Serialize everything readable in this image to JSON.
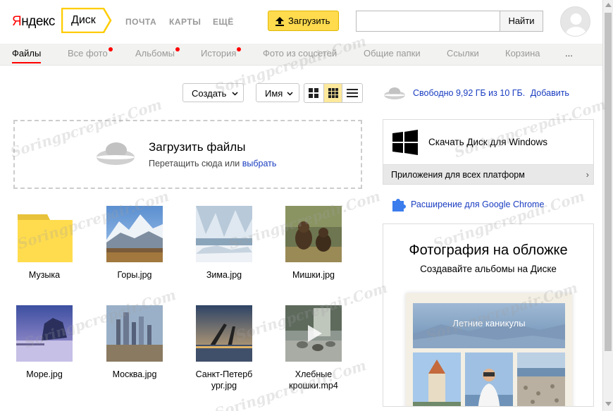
{
  "header": {
    "logo": "Яндекс",
    "service": "Диск",
    "nav": [
      "ПОЧТА",
      "КАРТЫ",
      "ЕЩЁ"
    ],
    "upload_button": "Загрузить",
    "search_placeholder": "",
    "search_button": "Найти",
    "avatar_icon": "user-avatar-icon"
  },
  "tabs": [
    {
      "label": "Файлы",
      "active": true,
      "dot": false
    },
    {
      "label": "Все фото",
      "active": false,
      "dot": true
    },
    {
      "label": "Альбомы",
      "active": false,
      "dot": true
    },
    {
      "label": "История",
      "active": false,
      "dot": true
    },
    {
      "label": "Фото из соцсетей",
      "active": false,
      "dot": false
    },
    {
      "label": "Общие папки",
      "active": false,
      "dot": false
    },
    {
      "label": "Ссылки",
      "active": false,
      "dot": false
    },
    {
      "label": "Корзина",
      "active": false,
      "dot": false
    },
    {
      "label": "...",
      "active": false,
      "dot": false
    }
  ],
  "toolbar": {
    "create_button": "Создать",
    "sort_button": "Имя",
    "view_modes": [
      "large-tiles",
      "small-tiles",
      "list"
    ],
    "active_view": "small-tiles"
  },
  "dropzone": {
    "title": "Загрузить файлы",
    "subtitle": "Перетащить сюда или",
    "link": "выбрать"
  },
  "files": [
    {
      "name": "Музыка",
      "type": "folder"
    },
    {
      "name": "Горы.jpg",
      "type": "image"
    },
    {
      "name": "Зима.jpg",
      "type": "image"
    },
    {
      "name": "Мишки.jpg",
      "type": "image"
    },
    {
      "name": "Море.jpg",
      "type": "image"
    },
    {
      "name": "Москва.jpg",
      "type": "image"
    },
    {
      "name": "Санкт-Петербург.jpg",
      "name_line1": "Санкт-Петерб",
      "name_line2": "ург.jpg",
      "type": "image"
    },
    {
      "name": "Хлебные крошки.mp4",
      "name_line1": "Хлебные",
      "name_line2": "крошки.mp4",
      "type": "video"
    }
  ],
  "sidebar": {
    "free_space": "Свободно 9,92 ГБ из 10 ГБ.",
    "add_link": "Добавить",
    "download_windows": "Скачать Диск для Windows",
    "all_platforms": "Приложения для всех платформ",
    "chrome_extension": "Расширение для Google Chrome",
    "promo_title": "Фотография на обложке",
    "promo_subtitle": "Создавайте альбомы на Диске",
    "album_banner": "Летние каникулы"
  },
  "watermark": "Soringpcrepair.Com",
  "colors": {
    "accent_yellow": "#ffdb4d",
    "active_tab_underline": "#ff0000",
    "link": "#1a3dc1",
    "folder": "#ffdc4e"
  }
}
